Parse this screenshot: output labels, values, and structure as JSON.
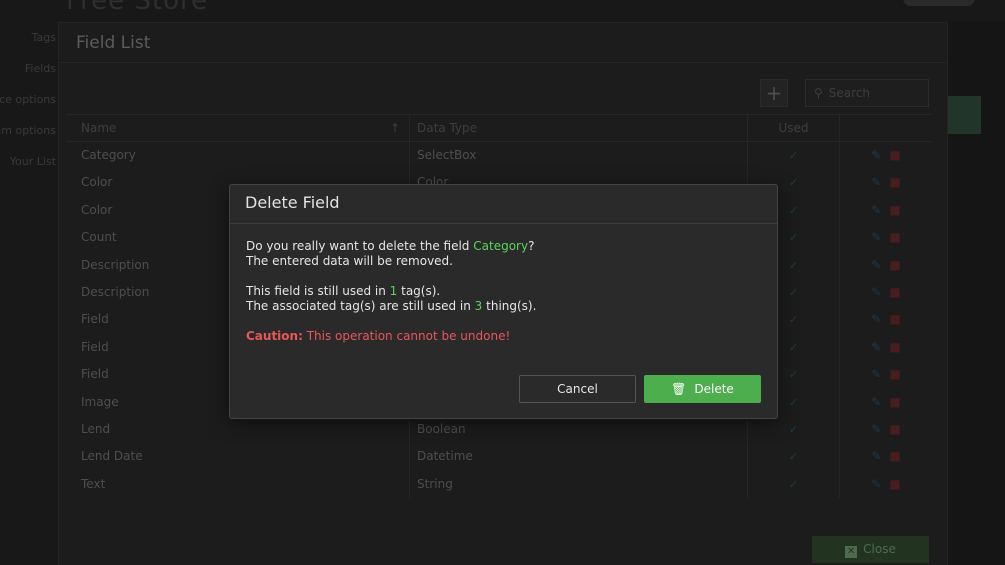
{
  "app": {
    "title": "Free Store"
  },
  "sidebar": {
    "items": [
      {
        "label": "Tags"
      },
      {
        "label": "Fields"
      },
      {
        "label": "Choice options"
      },
      {
        "label": "Program options"
      },
      {
        "label": "Your List"
      }
    ]
  },
  "panel": {
    "title": "Field List",
    "search_placeholder": "Search",
    "add_icon": "plus-icon",
    "close_label": "Close"
  },
  "table": {
    "headers": {
      "name": "Name",
      "type": "Data Type",
      "used": "Used"
    },
    "rows": [
      {
        "name": "Category",
        "type": "SelectBox"
      },
      {
        "name": "Color",
        "type": "Color"
      },
      {
        "name": "Color",
        "type": ""
      },
      {
        "name": "Count",
        "type": ""
      },
      {
        "name": "Description",
        "type": ""
      },
      {
        "name": "Description",
        "type": ""
      },
      {
        "name": "Field",
        "type": ""
      },
      {
        "name": "Field",
        "type": ""
      },
      {
        "name": "Field",
        "type": ""
      },
      {
        "name": "Image",
        "type": ""
      },
      {
        "name": "Lend",
        "type": "Boolean"
      },
      {
        "name": "Lend Date",
        "type": "Datetime"
      },
      {
        "name": "Text",
        "type": "String"
      }
    ]
  },
  "modal": {
    "title": "Delete Field",
    "line1_prefix": "Do you really want to delete the field ",
    "field_name": "Category",
    "line1_suffix": "?",
    "line2": "The entered data will be removed.",
    "line3_prefix": "This field is still used in ",
    "tag_count": "1",
    "line3_suffix": " tag(s).",
    "line4_prefix": "The associated tag(s) are still used in ",
    "thing_count": "3",
    "line4_suffix": " thing(s).",
    "caution_label": "Caution:",
    "caution_text": " This operation cannot be undone!",
    "cancel_label": "Cancel",
    "delete_label": "Delete"
  },
  "colors": {
    "accent_green": "#4cae4c",
    "highlight_green": "#5ad45a",
    "caution_red": "#e85757"
  }
}
